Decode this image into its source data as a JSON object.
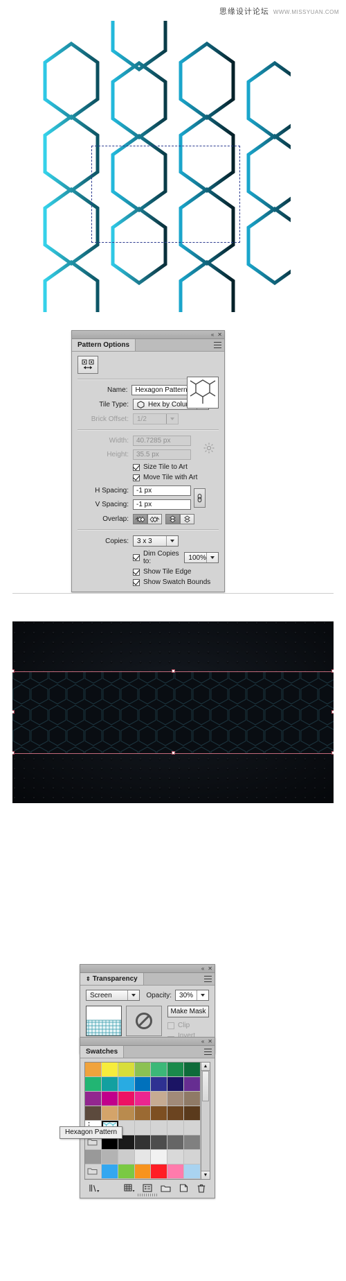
{
  "watermark": {
    "cn": "思缘设计论坛",
    "url": "WWW.MISSYUAN.COM"
  },
  "artboard": {
    "name": "hexagon-pattern-artwork",
    "selection_label": "pattern tile bounds",
    "stroke_colors": [
      "#2ec8e6",
      "#1ab4d4",
      "#1b8fa8",
      "#0f5e70",
      "#0a3b47",
      "#06222a"
    ]
  },
  "pattern_options": {
    "tab_label": "Pattern Options",
    "tool_icon": "pattern-tile-tool-icon",
    "name_label": "Name:",
    "name_value": "Hexagon Pattern",
    "tile_type_label": "Tile Type:",
    "tile_type_value": "Hex by Column",
    "tile_type_icon": "hexagon-icon",
    "brick_offset_label": "Brick Offset:",
    "brick_offset_value": "1/2",
    "width_label": "Width:",
    "width_value": "40.7285 px",
    "height_label": "Height:",
    "height_value": "35.5 px",
    "size_tile_label": "Size Tile to Art",
    "size_tile_checked": true,
    "move_tile_label": "Move Tile with Art",
    "move_tile_checked": true,
    "h_spacing_label": "H Spacing:",
    "h_spacing_value": "-1 px",
    "v_spacing_label": "V Spacing:",
    "v_spacing_value": "-1 px",
    "link_icon": "chain-link-icon",
    "overlap_label": "Overlap:",
    "overlap_buttons": [
      {
        "icon": "overlap-right-in-front-icon",
        "active": true
      },
      {
        "icon": "overlap-left-in-front-icon",
        "active": false
      },
      {
        "icon": "overlap-bottom-in-front-icon",
        "active": true
      },
      {
        "icon": "overlap-top-in-front-icon",
        "active": false
      }
    ],
    "copies_label": "Copies:",
    "copies_value": "3 x 3",
    "dim_copies_label": "Dim Copies to:",
    "dim_copies_checked": true,
    "dim_copies_value": "100%",
    "show_tile_edge_label": "Show Tile Edge",
    "show_tile_edge_checked": true,
    "show_swatch_bounds_label": "Show Swatch Bounds",
    "show_swatch_bounds_checked": true,
    "collapse_icon": "collapse-icon",
    "close_icon": "close-icon",
    "menu_icon": "panel-menu-icon"
  },
  "banner": {
    "name": "dark-hexagon-banner",
    "background": "#0a0d12",
    "selection_color": "#c2697a",
    "hex_stroke": "#1d3a45"
  },
  "transparency": {
    "tab_label": "Transparency",
    "blend_mode": "Screen",
    "opacity_label": "Opacity:",
    "opacity_value": "30%",
    "make_mask_label": "Make Mask",
    "clip_label": "Clip",
    "clip_checked": false,
    "invert_mask_label": "Invert Mask",
    "invert_mask_checked": false,
    "no_mask_icon": "no-mask-icon",
    "collapse_icon": "collapse-icon",
    "close_icon": "close-icon",
    "menu_icon": "panel-menu-icon"
  },
  "swatches": {
    "tab_label": "Swatches",
    "tooltip": "Hexagon Pattern",
    "collapse_icon": "collapse-icon",
    "close_icon": "close-icon",
    "menu_icon": "panel-menu-icon",
    "rows": [
      [
        "#f0a33c",
        "#f6ec3c",
        "#d8dd3a",
        "#8cc152",
        "#3cb878",
        "#1a8a4b",
        "#0e6b3a"
      ],
      [
        "#22b573",
        "#13a0a0",
        "#29abe2",
        "#0071bc",
        "#2e3192",
        "#1b1464",
        "#662d91"
      ],
      [
        "#92278f",
        "#c1008b",
        "#ed1164",
        "#ec268f",
        "#c6ab92",
        "#a18a78",
        "#8f7a66"
      ],
      [
        "#5c4a3d",
        "#d4a46a",
        "#b98b4e",
        "#9b6a33",
        "#7d4f22",
        "#6b4420",
        "#5a3a1c"
      ],
      [
        "pattern-dotted",
        "pattern-hexagon",
        "#d4d4d4",
        "#d4d4d4",
        "#d4d4d4",
        "#d4d4d4",
        "#d4d4d4"
      ],
      [
        "folder",
        "#000000",
        "#1a1a1a",
        "#333333",
        "#4d4d4d",
        "#666666",
        "#808080"
      ],
      [
        "#999999",
        "#b3b3b3",
        "#cccccc",
        "#e6e6e6",
        "#f2f2f2",
        "#d9d9d9",
        "#d4d4d4"
      ],
      [
        "folder",
        "#33a7f0",
        "#7ac943",
        "#f7931e",
        "#ff1d25",
        "#ff7bac",
        "#a9d3f0"
      ]
    ],
    "footer_icons": [
      "swatch-libraries-icon",
      "show-swatch-kinds-icon",
      "swatch-options-icon",
      "new-color-group-icon",
      "new-swatch-icon",
      "delete-swatch-icon"
    ]
  }
}
